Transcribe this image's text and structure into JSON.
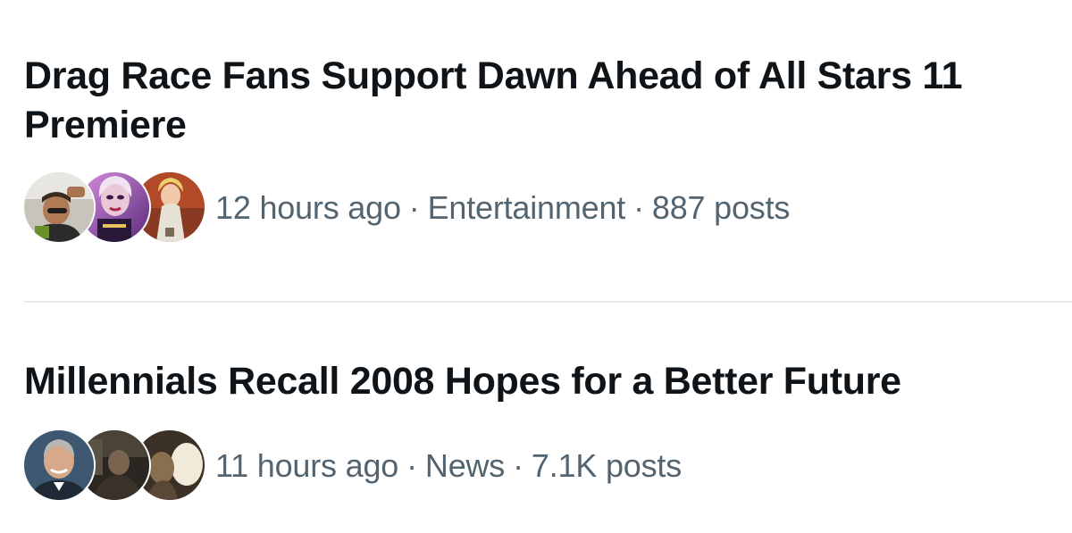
{
  "trends": [
    {
      "headline": "Drag Race Fans Support Dawn Ahead of All Stars 11 Premiere",
      "time": "12 hours ago",
      "category": "Entertainment",
      "posts": "887 posts",
      "avatars": [
        "avatar-fan-photo",
        "avatar-queen-portrait",
        "avatar-queen-gown"
      ]
    },
    {
      "headline": "Millennials Recall 2008 Hopes for a Better Future",
      "time": "11 hours ago",
      "category": "News",
      "posts": "7.1K posts",
      "avatars": [
        "avatar-man-portrait",
        "avatar-dark-scene",
        "avatar-sepia-photo"
      ]
    }
  ],
  "separator": "·",
  "colors": {
    "headline": "#0f1419",
    "meta": "#536471",
    "divider": "#e6e8ea"
  }
}
